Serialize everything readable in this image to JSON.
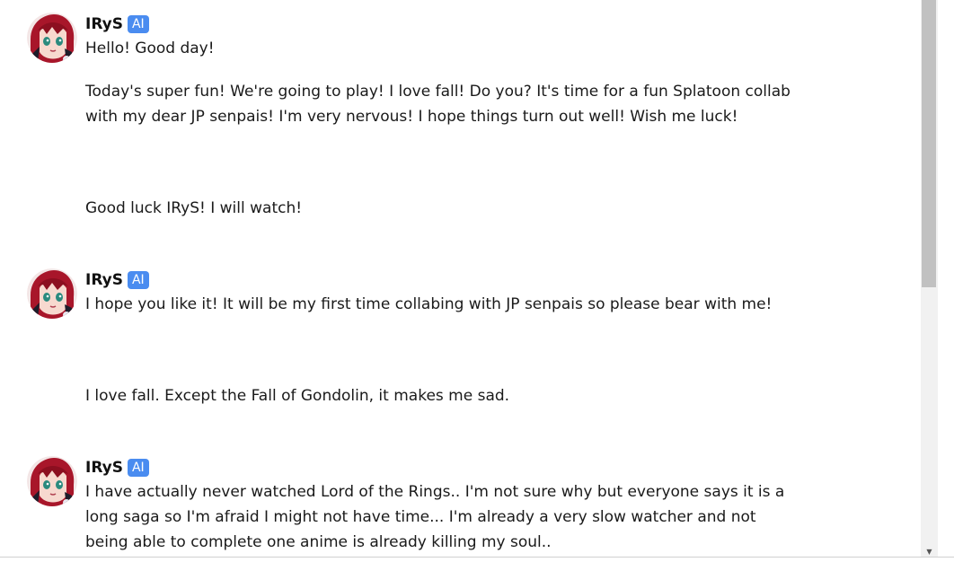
{
  "messages": [
    {
      "author": "IRyS",
      "badge": "AI",
      "paragraphs": [
        "Hello! Good day!",
        "Today's super fun! We're going to play! I love fall! Do you? It's time for a fun Splatoon collab with my dear JP senpais! I'm very nervous! I hope things turn out well! Wish me luck!"
      ]
    },
    {
      "user_text": "Good luck IRyS! I will watch!"
    },
    {
      "author": "IRyS",
      "badge": "AI",
      "paragraphs": [
        "I hope you like it! It will be my first time collabing with JP senpais so please bear with me!"
      ]
    },
    {
      "user_text": "I love fall. Except the Fall of Gondolin, it makes me sad."
    },
    {
      "author": "IRyS",
      "badge": "AI",
      "paragraphs": [
        "I have actually never watched Lord of the Rings.. I'm not sure why but everyone says it is a long saga so I'm afraid I might not have time... I'm already a very slow watcher and not being able to complete one anime is already killing my soul.."
      ]
    }
  ],
  "colors": {
    "ai_badge": "#4a8cf0",
    "text": "#1a1a1a",
    "scrollbar_track": "#f1f1f1",
    "scrollbar_thumb": "#c1c1c1"
  },
  "icons": {
    "avatar": "character-avatar",
    "scroll_down": "chevron-down-icon"
  }
}
